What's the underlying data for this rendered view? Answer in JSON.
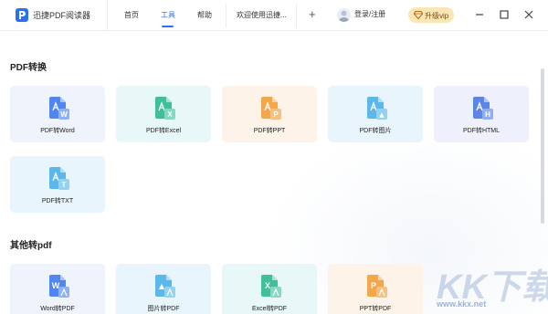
{
  "titlebar": {
    "app_name": "迅捷PDF阅读器",
    "tabs": [
      {
        "label": "首页"
      },
      {
        "label": "工具"
      },
      {
        "label": "帮助"
      }
    ],
    "welcome_tab": "欢迎使用迅捷...",
    "add_tab": "+",
    "login": "登录/注册",
    "vip": "升级vip",
    "colors": {
      "accent": "#2b6ff3",
      "vip_bg": "#fbe7b6"
    }
  },
  "sections": [
    {
      "title": "PDF转换",
      "items": [
        {
          "label": "PDF转Word",
          "icon": "pdf-to-word-icon",
          "badge": "W",
          "color": "#4f86ef"
        },
        {
          "label": "PDF转Excel",
          "icon": "pdf-to-excel-icon",
          "badge": "X",
          "color": "#3fbf9a"
        },
        {
          "label": "PDF转PPT",
          "icon": "pdf-to-ppt-icon",
          "badge": "P",
          "color": "#f4a64a"
        },
        {
          "label": "PDF转图片",
          "icon": "pdf-to-image-icon",
          "badge": "▲",
          "color": "#5bb7ec"
        },
        {
          "label": "PDF转HTML",
          "icon": "pdf-to-html-icon",
          "badge": "H",
          "color": "#5b86e8"
        },
        {
          "label": "PDF转TXT",
          "icon": "pdf-to-txt-icon",
          "badge": "T",
          "color": "#5bb7ec"
        }
      ]
    },
    {
      "title": "其他转pdf",
      "items": [
        {
          "label": "Word转PDF",
          "icon": "word-to-pdf-icon",
          "badge": "W",
          "color": "#4f86ef"
        },
        {
          "label": "图片转PDF",
          "icon": "image-to-pdf-icon",
          "badge": "▲",
          "color": "#5bb7ec"
        },
        {
          "label": "Excel转PDF",
          "icon": "excel-to-pdf-icon",
          "badge": "X",
          "color": "#3fbf9a"
        },
        {
          "label": "PPT转PDF",
          "icon": "ppt-to-pdf-icon",
          "badge": "P",
          "color": "#f4a64a"
        }
      ]
    }
  ],
  "watermark": {
    "logo": "KK下载",
    "url": "www.kkx.net"
  }
}
